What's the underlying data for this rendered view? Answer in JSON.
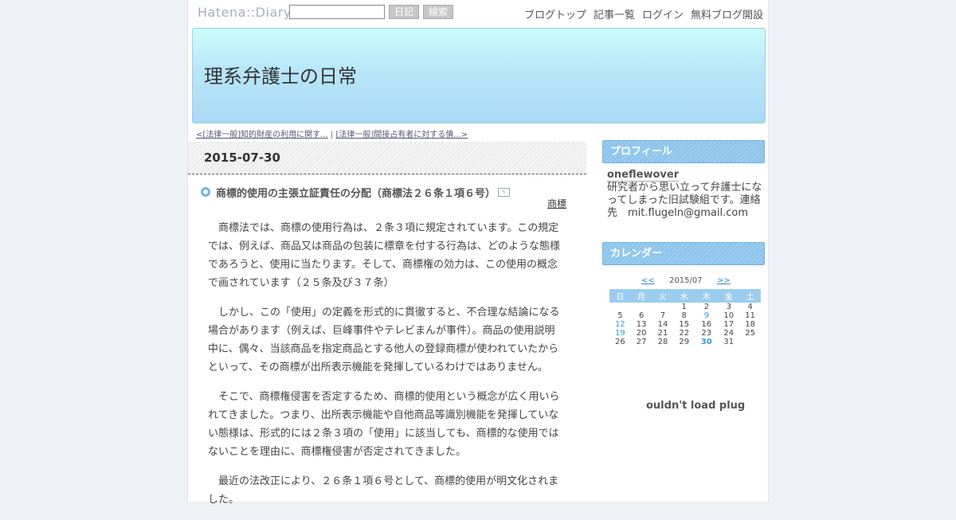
{
  "topbar": {
    "logo": "Hatena::Diary",
    "diary_button": "日記",
    "search_button": "検索",
    "links": [
      "ブログトップ",
      "記事一覧",
      "ログイン",
      "無料ブログ開設"
    ]
  },
  "header": {
    "title": "理系弁護士の日常"
  },
  "pager": {
    "prev": "<[法律一般]知的財産の利用に関す...",
    "separator": "|",
    "next": "[法律一般]間接占有者に対する債...>"
  },
  "entry": {
    "date": "2015-07-30",
    "title": "商標的使用の主張立証責任の分配（商標法２６条１項６号）",
    "category": "商標",
    "paragraphs": [
      "商標法では、商標の使用行為は、２条３項に規定されています。この規定では、例えば、商品又は商品の包装に標章を付する行為は、どのような態様であろうと、使用に当たります。そして、商標権の効力は、この使用の概念で画されています（２５条及び３７条）",
      "しかし、この「使用」の定義を形式的に貫徹すると、不合理な結論になる場合があります（例えば、巨峰事件やテレビまんが事件）。商品の使用説明中に、偶々、当該商品を指定商品とする他人の登録商標が使われていたからといって、その商標が出所表示機能を発揮しているわけではありません。",
      "そこで、商標権侵害を否定するため、商標的使用という概念が広く用いられてきました。つまり、出所表示機能や自他商品等識別機能を発揮していない態様は、形式的には２条３項の「使用」に該当しても、商標的な使用ではないことを理由に、商標権侵害が否定されてきました。",
      "最近の法改正により、２６条１項６号として、商標的使用が明文化されました。"
    ]
  },
  "sidebar": {
    "profile_heading": "プロフィール",
    "profile_name": "oneflewover",
    "profile_text": "研究者から思い立って弁護士になってしまった旧試験組です。連絡先　mit.flugeln@gmail.com",
    "calendar_heading": "カレンダー",
    "calendar": {
      "prev": "<<",
      "month": "2015/07",
      "next": ">>",
      "weekdays": [
        "日",
        "月",
        "火",
        "水",
        "木",
        "金",
        "土"
      ],
      "weeks": [
        [
          "",
          "",
          "",
          "1",
          "2",
          "3",
          "4"
        ],
        [
          "5",
          "6",
          "7",
          "8",
          "9",
          "10",
          "11"
        ],
        [
          "12",
          "13",
          "14",
          "15",
          "16",
          "17",
          "18"
        ],
        [
          "19",
          "20",
          "21",
          "22",
          "23",
          "24",
          "25"
        ],
        [
          "26",
          "27",
          "28",
          "29",
          "30",
          "31",
          ""
        ]
      ],
      "linked_days": [
        "9",
        "12",
        "19"
      ],
      "today": "30"
    },
    "plugin_message": "ouldn't load plug"
  }
}
